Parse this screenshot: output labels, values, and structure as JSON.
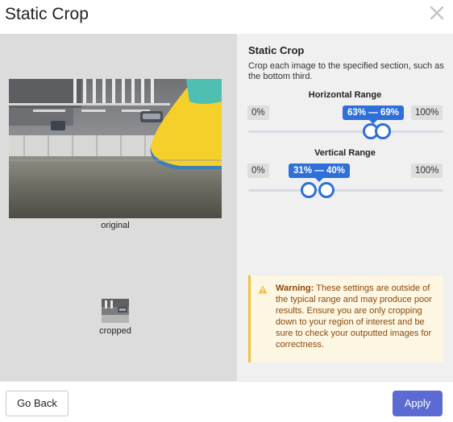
{
  "dialog": {
    "title": "Static Crop",
    "close_icon": "close-icon"
  },
  "preview": {
    "original_label": "original",
    "cropped_label": "cropped"
  },
  "settings": {
    "title": "Static Crop",
    "description": "Crop each image to the specified section, such as the bottom third.",
    "horizontal": {
      "label": "Horizontal Range",
      "min_label": "0%",
      "max_label": "100%",
      "value_label": "63% — 69%",
      "low": 0.63,
      "high": 0.69
    },
    "vertical": {
      "label": "Vertical Range",
      "min_label": "0%",
      "max_label": "100%",
      "value_label": "31% — 40%",
      "low": 0.31,
      "high": 0.4
    },
    "warning": {
      "icon": "warning-icon",
      "heading": "Warning:",
      "body": "These settings are outside of the typical range and may produce poor results. Ensure you are only cropping down to your region of interest and be sure to check your outputted images for correctness."
    }
  },
  "footer": {
    "back_label": "Go Back",
    "apply_label": "Apply"
  },
  "colors": {
    "accent": "#2f6fd8",
    "apply": "#5b6bd3",
    "warning_border": "#f3c23d",
    "warning_text": "#8a4b10"
  }
}
